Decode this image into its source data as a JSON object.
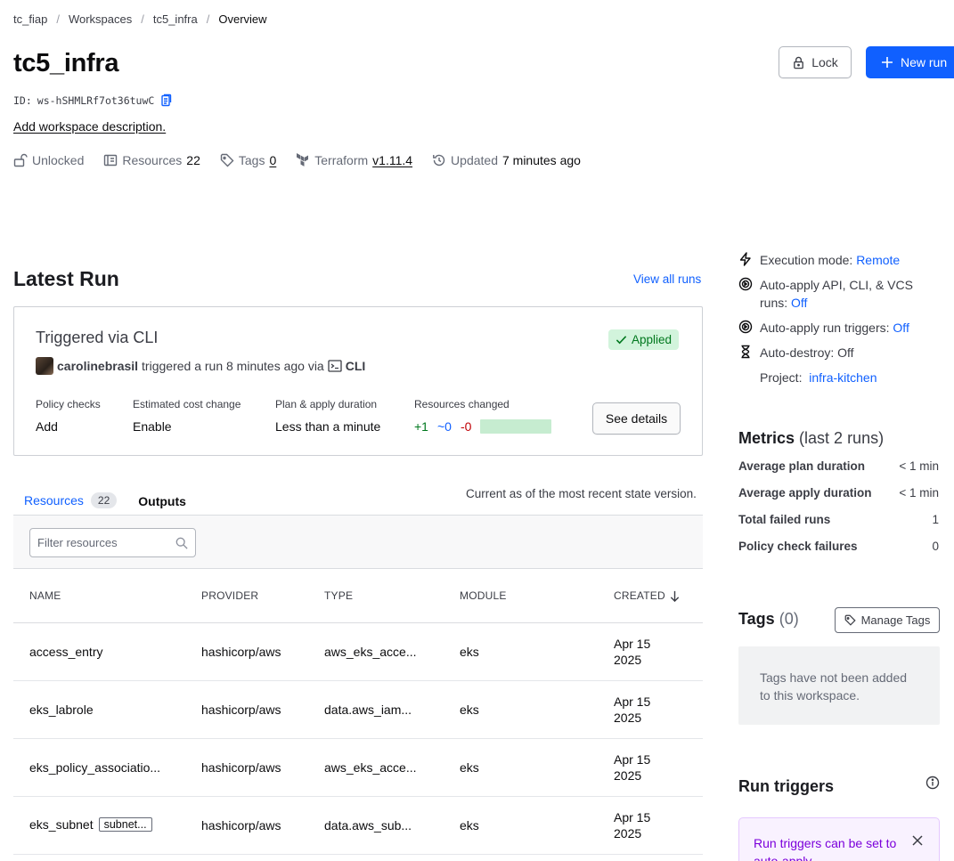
{
  "breadcrumb": [
    "tc_fiap",
    "Workspaces",
    "tc5_infra",
    "Overview"
  ],
  "workspace": {
    "name": "tc5_infra",
    "id_label": "ID:",
    "id": "ws-hSHMLRf7ot36tuwC",
    "add_description": "Add workspace description."
  },
  "meta": {
    "lock_state": "Unlocked",
    "resources_label": "Resources",
    "resources_count": "22",
    "tags_label": "Tags",
    "tags_count": "0",
    "terraform_label": "Terraform",
    "terraform_version": "v1.11.4",
    "updated_label": "Updated",
    "updated_value": "7 minutes ago"
  },
  "actions": {
    "lock": "Lock",
    "new_run": "New run"
  },
  "latest_run": {
    "title": "Latest Run",
    "view_all": "View all runs",
    "trigger": "Triggered via CLI",
    "status": "Applied",
    "user": "carolinebrasil",
    "action_text": "triggered a run 8 minutes ago via",
    "via": "CLI",
    "stats": {
      "policy_label": "Policy checks",
      "policy_value": "Add",
      "cost_label": "Estimated cost change",
      "cost_value": "Enable",
      "duration_label": "Plan & apply duration",
      "duration_value": "Less than a minute",
      "changed_label": "Resources changed",
      "added": "+1",
      "changed": "~0",
      "destroyed": "-0"
    },
    "see_details": "See details"
  },
  "tabs": {
    "resources": "Resources",
    "resources_count": "22",
    "outputs": "Outputs",
    "state_note": "Current as of the most recent state version."
  },
  "filter": {
    "placeholder": "Filter resources"
  },
  "table": {
    "headers": {
      "name": "NAME",
      "provider": "PROVIDER",
      "type": "TYPE",
      "module": "MODULE",
      "created": "CREATED"
    },
    "rows": [
      {
        "name": "access_entry",
        "provider": "hashicorp/aws",
        "type": "aws_eks_acce...",
        "module": "eks",
        "created_1": "Apr 15",
        "created_2": "2025"
      },
      {
        "name": "eks_labrole",
        "provider": "hashicorp/aws",
        "type": "data.aws_iam...",
        "module": "eks",
        "created_1": "Apr 15",
        "created_2": "2025"
      },
      {
        "name": "eks_policy_associatio...",
        "provider": "hashicorp/aws",
        "type": "aws_eks_acce...",
        "module": "eks",
        "created_1": "Apr 15",
        "created_2": "2025"
      },
      {
        "name": "eks_subnet",
        "tag": "subnet...",
        "provider": "hashicorp/aws",
        "type": "data.aws_sub...",
        "module": "eks",
        "created_1": "Apr 15",
        "created_2": "2025"
      }
    ]
  },
  "sidebar": {
    "execution_label": "Execution mode:",
    "execution_value": "Remote",
    "autoapply_label": "Auto-apply API, CLI, & VCS runs:",
    "autoapply_value": "Off",
    "autoapply_triggers_label": "Auto-apply run triggers:",
    "autoapply_triggers_value": "Off",
    "autodestroy_label": "Auto-destroy:",
    "autodestroy_value": "Off",
    "project_label": "Project:",
    "project_value": "infra-kitchen",
    "metrics": {
      "title": "Metrics",
      "subtitle": "(last 2 runs)",
      "avg_plan_label": "Average plan duration",
      "avg_plan_value": "< 1 min",
      "avg_apply_label": "Average apply duration",
      "avg_apply_value": "< 1 min",
      "failed_label": "Total failed runs",
      "failed_value": "1",
      "policy_fail_label": "Policy check failures",
      "policy_fail_value": "0"
    },
    "tags": {
      "title": "Tags",
      "count": "(0)",
      "manage": "Manage Tags",
      "empty": "Tags have not been added to this workspace."
    },
    "run_triggers": {
      "title": "Run triggers",
      "note": "Run triggers can be set to auto-apply"
    }
  },
  "colors": {
    "primary": "#1060ff",
    "success": "#00781e",
    "danger": "#c00005",
    "highlight": "#7b00db"
  }
}
